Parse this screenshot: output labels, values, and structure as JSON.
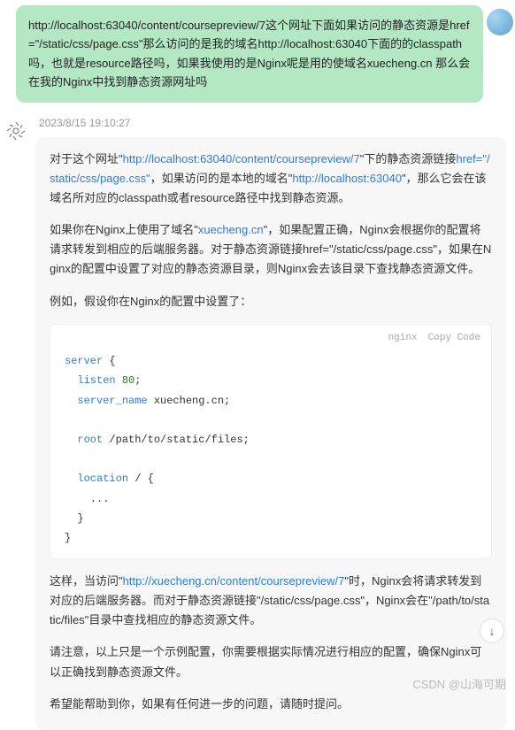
{
  "user": {
    "msg_p1a": "http://localhost:63040/content/coursepreview/7",
    "msg_p1b": "这个网址下面如果访问的静态资源是href=\"/static/css/page.css\"那么访问的是我的域名http://localhost:63040下面的的classpath吗，也就是resource路径吗，如果我使用的是Nginx呢是用的使域名xuecheng.cn 那么会在我的Nginx中找到静态资源网址吗"
  },
  "timestamp": "2023/8/15 19:10:27",
  "ai": {
    "p1_a": "对于这个网址\"",
    "p1_link1": "http://localhost:63040/content/coursepreview/7",
    "p1_b": "\"下的静态资源链接",
    "p1_link2": "href=\"/static/css/page.css\"",
    "p1_c": "，如果访问的是本地的域名\"",
    "p1_link3": "http://localhost:63040",
    "p1_d": "\"，那么它会在该域名所对应的classpath或者resource路径中找到静态资源。",
    "p2_a": "如果你在Nginx上使用了域名\"",
    "p2_link1": "xuecheng.cn",
    "p2_b": "\"，如果配置正确，Nginx会根据你的配置将请求转发到相应的后端服务器。对于静态资源链接href=\"/static/css/page.css\"，如果在Nginx的配置中设置了对应的静态资源目录，则Nginx会去该目录下查找静态资源文件。",
    "p3": "例如，假设你在Nginx的配置中设置了：",
    "p4_a": "这样，当访问\"",
    "p4_link1": "http://xuecheng.cn/content/coursepreview/7",
    "p4_b": "\"时，Nginx会将请求转发到对应的后端服务器。而对于静态资源链接\"/static/css/page.css\"，Nginx会在\"/path/to/static/files\"目录中查找相应的静态资源文件。",
    "p5": "请注意，以上只是一个示例配置，你需要根据实际情况进行相应的配置，确保Nginx可以正确找到静态资源文件。",
    "p6": "希望能帮助到你，如果有任何进一步的问题，请随时提问。"
  },
  "code": {
    "lang": "nginx",
    "copy": "Copy Code",
    "kw_server": "server",
    "kw_listen": "listen",
    "num_80": "80",
    "kw_servername": "server_name",
    "val_servername": " xuecheng.cn;",
    "kw_root": "root",
    "val_root": " /path/to/static/files;",
    "kw_location": "location",
    "val_location": " / {",
    "dots": "    ...",
    "close1": "  }",
    "close2": "}"
  },
  "watermark": "CSDN @山海可期",
  "scroll_icon": "↓"
}
